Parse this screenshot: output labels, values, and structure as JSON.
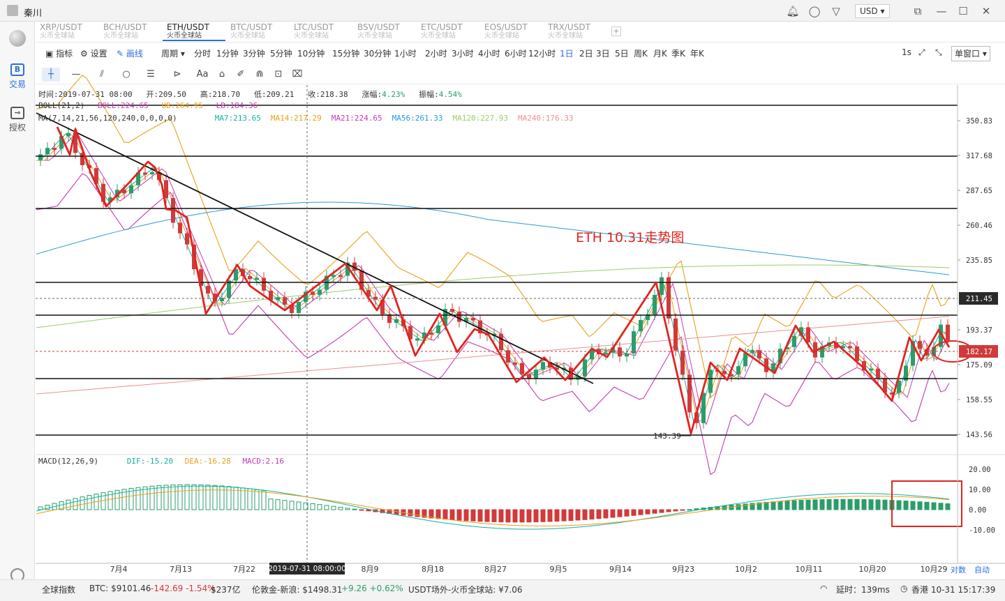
{
  "window": {
    "user_name": "秦川",
    "currency": "USD"
  },
  "sidebar": {
    "trade_label": "交易",
    "trade_icon_text": "B",
    "auth_label": "授权"
  },
  "pair_tabs": [
    {
      "pair": "XRP/USDT",
      "source": "火币全球站"
    },
    {
      "pair": "BCH/USDT",
      "source": "火币全球站"
    },
    {
      "pair": "ETH/USDT",
      "source": "火币全球站",
      "active": true
    },
    {
      "pair": "BTC/USDT",
      "source": "火币全球站"
    },
    {
      "pair": "LTC/USDT",
      "source": "火币全球站"
    },
    {
      "pair": "BSV/USDT",
      "source": "火币全球站"
    },
    {
      "pair": "ETC/USDT",
      "source": "火币全球站"
    },
    {
      "pair": "EOS/USDT",
      "source": "火币全球站"
    },
    {
      "pair": "TRX/USDT",
      "source": "火币全球站"
    }
  ],
  "toolbar": {
    "indicator": "指标",
    "settings": "设置",
    "draw": "画线",
    "period": "周期",
    "periods": [
      "分时",
      "1分钟",
      "3分钟",
      "5分钟",
      "10分钟",
      "15分钟",
      "30分钟",
      "1小时",
      "2小时",
      "3小时",
      "4小时",
      "6小时",
      "12小时",
      "1日",
      "2日",
      "3日",
      "5日",
      "周K",
      "月K",
      "季K",
      "年K"
    ],
    "selected_period": "1日",
    "right_interval": "1s",
    "window_mode": "单窗口"
  },
  "ohlc": {
    "time_label": "时间:",
    "time": "2019-07-31 08:00",
    "open_label": "开:",
    "open": "209.50",
    "high_label": "高:",
    "high": "218.70",
    "low_label": "低:",
    "low": "209.21",
    "close_label": "收:",
    "close": "218.38",
    "change_label": "涨幅:",
    "change": "4.23%",
    "amplitude_label": "振幅:",
    "amplitude": "4.54%"
  },
  "boll": {
    "name": "BOLL(21,2)",
    "boll": "BOLL:224.65",
    "ub": "UB:264.95",
    "lb": "LB:184.36"
  },
  "ma": {
    "name": "MA(7,14,21,56,120,240,0,0,0,0)",
    "items": [
      {
        "text": "MA7:213.65",
        "color": "#16b0a0"
      },
      {
        "text": "MA14:217.29",
        "color": "#e6a11a"
      },
      {
        "text": "MA21:224.65",
        "color": "#c23cb0"
      },
      {
        "text": "MA56:261.33",
        "color": "#2b9ad6"
      },
      {
        "text": "MA120:227.93",
        "color": "#9ccc65"
      },
      {
        "text": "MA240:176.33",
        "color": "#ef8f8f"
      }
    ]
  },
  "annotation": {
    "title": "ETH 10.31走势图",
    "low_mark": "143.39"
  },
  "price_axis": {
    "ticks": [
      "350.83",
      "317.68",
      "287.65",
      "260.46",
      "235.85",
      "211.45",
      "193.37",
      "182.17",
      "175.09",
      "158.55",
      "143.56"
    ],
    "crosshair_price": "211.45",
    "current_price": "182.17"
  },
  "macd": {
    "name": "MACD(12,26,9)",
    "dif": "DIF:-15.20",
    "dea": "DEA:-16.28",
    "macd": "MACD:2.16",
    "ticks": [
      "20.00",
      "10.00",
      "0.00",
      "-10.00"
    ]
  },
  "dates": [
    "7月4",
    "7月13",
    "7月22",
    "8月9",
    "8月18",
    "8月27",
    "9月5",
    "9月14",
    "9月23",
    "10月2",
    "10月11",
    "10月20",
    "10月29"
  ],
  "crosshair_date": "2019-07-31 08:00:00",
  "axis_modes": {
    "log": "对数",
    "auto": "自动"
  },
  "statusbar": {
    "index": "全球指数",
    "btc": "BTC: $9101.46",
    "btc_change": "-142.69 -1.54%",
    "btc_vol": "$237亿",
    "gold": "伦敦金-新浪: $1498.31",
    "gold_change": "+9.26 +0.62%",
    "usdt": "USDT场外-火币全球站: ¥7.06",
    "latency": "延时：139ms",
    "clock": "香港 10-31 15:17:39"
  },
  "colors": {
    "up": "#2a9d6a",
    "down": "#d13a3a",
    "accent": "#2d6fd6"
  }
}
